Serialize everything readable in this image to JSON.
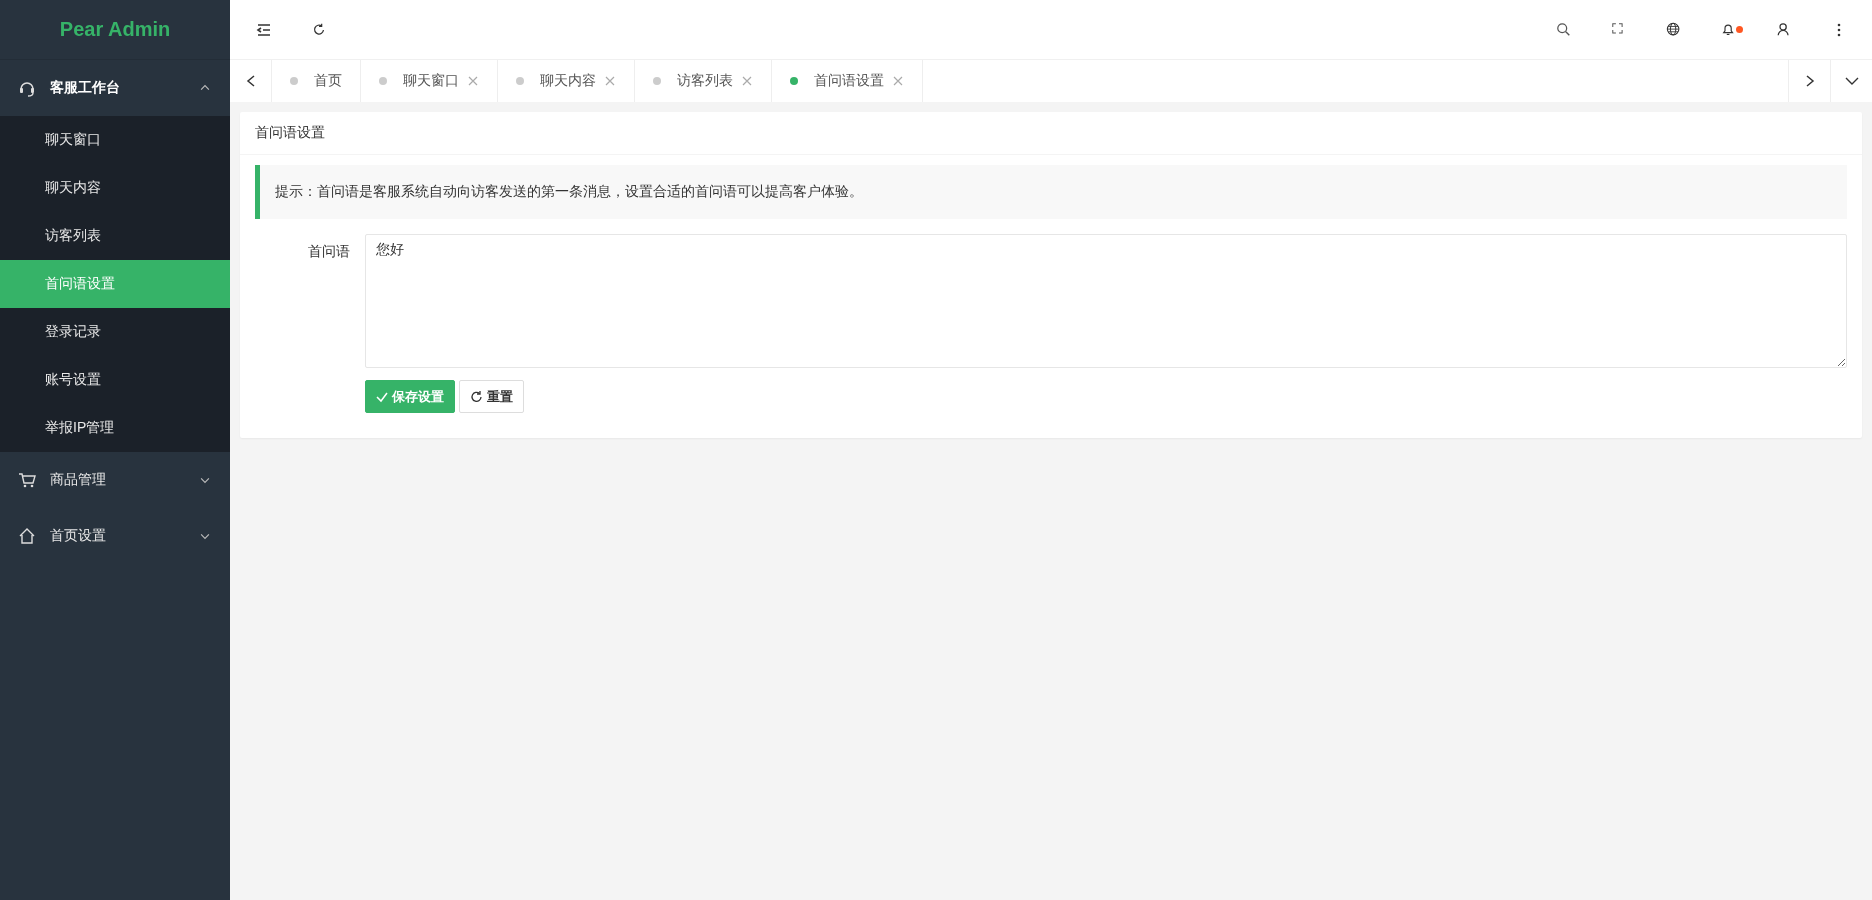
{
  "sidebar": {
    "logo": "Pear Admin",
    "menu": [
      {
        "label": "客服工作台",
        "kind": "headset",
        "expanded": true,
        "children": [
          {
            "label": "聊天窗口",
            "selected": false
          },
          {
            "label": "聊天内容",
            "selected": false
          },
          {
            "label": "访客列表",
            "selected": false
          },
          {
            "label": "首问语设置",
            "selected": true
          },
          {
            "label": "登录记录",
            "selected": false
          },
          {
            "label": "账号设置",
            "selected": false
          },
          {
            "label": "举报IP管理",
            "selected": false
          }
        ]
      },
      {
        "label": "商品管理",
        "kind": "cart",
        "expanded": false
      },
      {
        "label": "首页设置",
        "kind": "home",
        "expanded": false
      }
    ]
  },
  "header": {
    "notifications": {
      "unread": true
    }
  },
  "tabs": [
    {
      "label": "首页",
      "selected": false,
      "closable": false
    },
    {
      "label": "聊天窗口",
      "selected": false,
      "closable": true
    },
    {
      "label": "聊天内容",
      "selected": false,
      "closable": true
    },
    {
      "label": "访客列表",
      "selected": false,
      "closable": true
    },
    {
      "label": "首问语设置",
      "selected": true,
      "closable": true
    }
  ],
  "card": {
    "title": "首问语设置",
    "tip": "提示：首问语是客服系统自动向访客发送的第一条消息，设置合适的首问语可以提高客户体验。",
    "field": {
      "label": "首问语",
      "value": "您好"
    },
    "buttons": [
      {
        "label": "保存设置",
        "kind": "primary"
      },
      {
        "label": "重置",
        "kind": "reset"
      }
    ]
  }
}
